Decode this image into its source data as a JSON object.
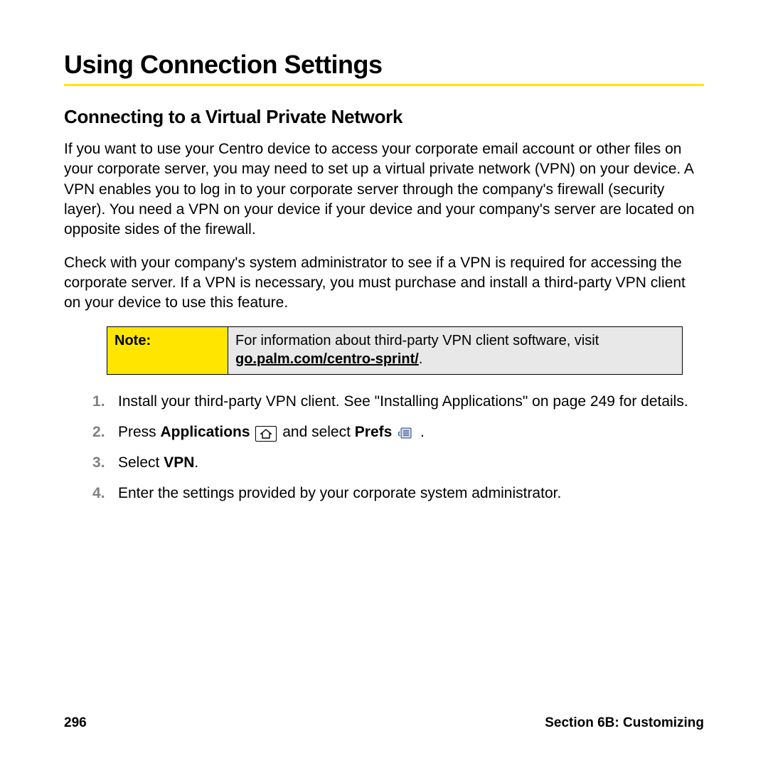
{
  "heading": "Using Connection Settings",
  "subheading": "Connecting to a Virtual Private Network",
  "para1": "If you want to use your Centro device to access your corporate email account or other files on your corporate server, you may need to set up a virtual private network (VPN) on your device. A VPN enables you to log in to your corporate server through the company's firewall (security layer). You need a VPN on your device if your device and your company's server are located on opposite sides of the firewall.",
  "para2": "Check with your company's system administrator to see if a VPN is required for accessing the corporate server. If a VPN is necessary, you must purchase and install a third-party VPN client on your device to use this feature.",
  "note": {
    "label": "Note:",
    "text_before_link": "For information about third-party VPN client software, visit ",
    "link": "go.palm.com/centro-sprint/",
    "text_after_link": "."
  },
  "steps": {
    "s1": "Install your third-party VPN client. See \"Installing Applications\" on page 249 for details.",
    "s2_press": "Press ",
    "s2_apps": "Applications",
    "s2_and": " and select ",
    "s2_prefs": "Prefs",
    "s2_end": " .",
    "s3_select": "Select ",
    "s3_vpn": "VPN",
    "s3_end": ".",
    "s4": "Enter the settings provided by your corporate system administrator."
  },
  "footer": {
    "page": "296",
    "section": "Section 6B: Customizing"
  }
}
